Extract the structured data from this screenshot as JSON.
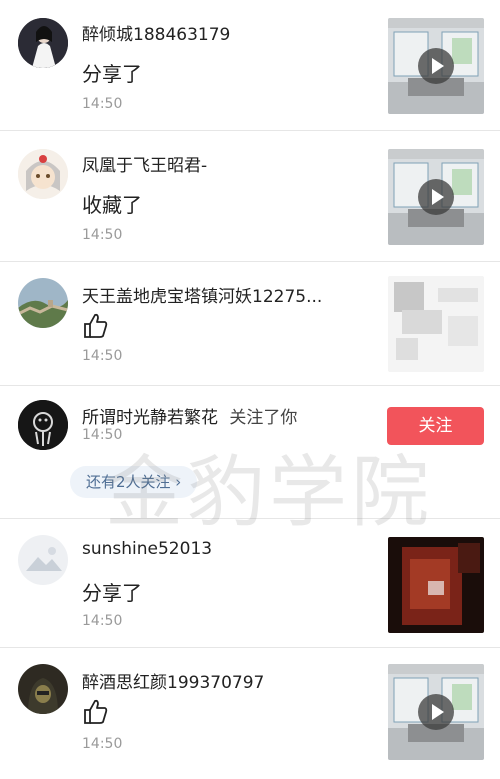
{
  "notifications": [
    {
      "name": "醉倾城188463179",
      "action": "分享了",
      "time": "14:50",
      "avatar_icon": "girl-avatar-icon",
      "thumb": "video-thumbnail"
    },
    {
      "name": "凤凰于飞王昭君-",
      "action": "收藏了",
      "time": "14:50",
      "avatar_icon": "anime-avatar-icon",
      "thumb": "video-thumbnail"
    },
    {
      "name": "天王盖地虎宝塔镇河妖12275...",
      "action": "",
      "time": "14:50",
      "avatar_icon": "greatwall-avatar-icon",
      "thumb": "blurred-thumbnail"
    },
    {
      "name": "所谓时光静若繁花",
      "action": "关注了你",
      "time": "14:50",
      "follow_label": "关注",
      "more_label": "还有2人关注 ›"
    },
    {
      "name": "sunshine52013",
      "action": "分享了",
      "time": "14:50",
      "thumb": "blurred-dark-thumbnail"
    },
    {
      "name": "醉酒思红颜199370797",
      "action": "",
      "time": "14:50",
      "thumb": "video-thumbnail"
    }
  ],
  "watermark": "金豹学院",
  "colors": {
    "accent": "#f2545b",
    "link": "#4f6e94"
  }
}
